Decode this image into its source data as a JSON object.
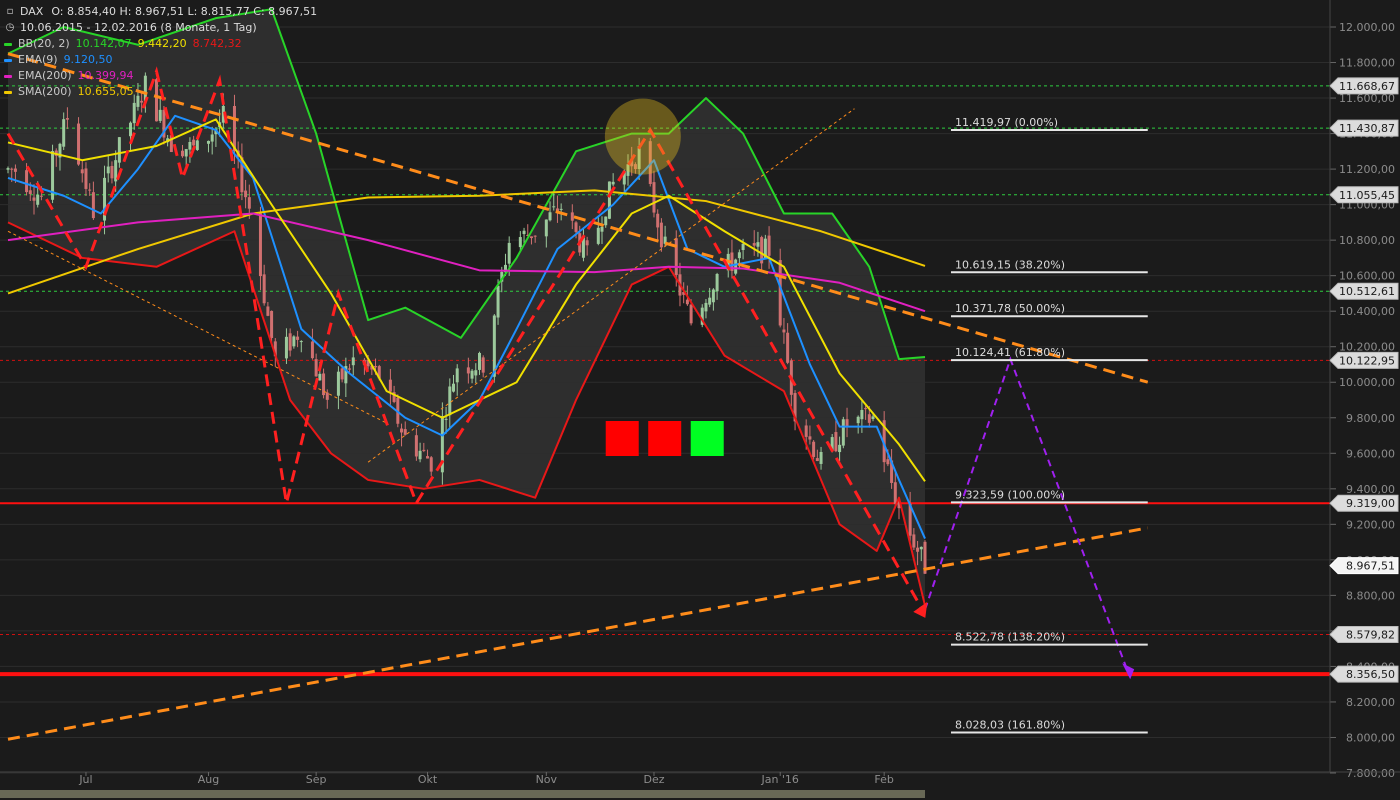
{
  "header": {
    "symbol": "DAX",
    "ohlc": "O: 8.854,40   H: 8.967,51   L: 8.815,77   C: 8.967,51",
    "period": "10.06.2015 - 12.02.2016 (8 Monate, 1 Tag)",
    "chart_icon": "candlestick-icon",
    "clock_icon": "clock-icon"
  },
  "legend": [
    {
      "name": "BB(20, 2)",
      "values": [
        "10.142,07",
        "9.442,20",
        "8.742,32"
      ],
      "colors": [
        "#28d428",
        "#f0e000",
        "#e81818"
      ],
      "color": "#28d428"
    },
    {
      "name": "EMA(9)",
      "values": [
        "9.120,50"
      ],
      "colors": [
        "#1e90ff"
      ],
      "color": "#1e90ff"
    },
    {
      "name": "EMA(200)",
      "values": [
        "10.399,94"
      ],
      "colors": [
        "#e020c0"
      ],
      "color": "#e020c0"
    },
    {
      "name": "SMA(200)",
      "values": [
        "10.655,05"
      ],
      "colors": [
        "#f0c800"
      ],
      "color": "#f0c800"
    }
  ],
  "colors": {
    "background": "#1b1b1b",
    "grid": "#2d2d2d",
    "axis_text": "#8c8c8c",
    "up": "#9cc99c",
    "down": "#d07070",
    "bb_mid": "#f0e000",
    "bb_upper": "#28d428",
    "bb_lower": "#e81818",
    "ema9": "#1e90ff",
    "ema200": "#e020c0",
    "sma200": "#f0c800",
    "trend": "#ff8c1a",
    "zigzag": "#ff2020",
    "projection": "#a020f0",
    "support": "#ff1010",
    "fib": "#e6e6e6",
    "hline": "#2ecc40"
  },
  "chart_data": {
    "type": "line",
    "title": "",
    "xlabel": "",
    "ylabel": "",
    "ylim": [
      7700,
      12100
    ],
    "y_ticks": [
      "12.000,00",
      "11.800,00",
      "11.600,00",
      "11.400,00",
      "11.200,00",
      "11.000,00",
      "10.800,00",
      "10.600,00",
      "10.400,00",
      "10.200,00",
      "10.000,00",
      "9.800,00",
      "9.600,00",
      "9.400,00",
      "9.200,00",
      "9.000,00",
      "8.800,00",
      "8.600,00",
      "8.400,00",
      "8.200,00",
      "8.000,00",
      "7.800,00"
    ],
    "x_labels": [
      {
        "label": "Jul",
        "date": "2015-07-01"
      },
      {
        "label": "Aug",
        "date": "2015-08-03"
      },
      {
        "label": "Sep",
        "date": "2015-09-01"
      },
      {
        "label": "Okt",
        "date": "2015-10-01"
      },
      {
        "label": "Nov",
        "date": "2015-11-02"
      },
      {
        "label": "Dez",
        "date": "2015-12-01"
      },
      {
        "label": "Jan '16",
        "date": "2016-01-04"
      },
      {
        "label": "Feb",
        "date": "2016-02-01"
      }
    ],
    "date_range": [
      "2015-06-10",
      "2016-02-12"
    ],
    "price_markers": [
      {
        "label": "11.668,67",
        "value": 11668.67,
        "style": "green"
      },
      {
        "label": "11.430,87",
        "value": 11430.87,
        "style": "green"
      },
      {
        "label": "11.055,45",
        "value": 11055.45,
        "style": "green"
      },
      {
        "label": "10.512,61",
        "value": 10512.61,
        "style": "green"
      },
      {
        "label": "10.122,95",
        "value": 10122.95,
        "style": "red-dotted"
      },
      {
        "label": "9.319,00",
        "value": 9319.0,
        "style": "red-solid"
      },
      {
        "label": "8.967,51",
        "value": 8967.51,
        "style": "current"
      },
      {
        "label": "8.579,82",
        "value": 8579.82,
        "style": "red-dotted"
      },
      {
        "label": "8.356,50",
        "value": 8356.5,
        "style": "red-thick"
      }
    ],
    "fibonacci": [
      {
        "label": "11.419,97 (0.00%)",
        "value": 11419.97
      },
      {
        "label": "10.619,15 (38.20%)",
        "value": 10619.15
      },
      {
        "label": "10.371,78 (50.00%)",
        "value": 10371.78
      },
      {
        "label": "10.124,41 (61.80%)",
        "value": 10124.41
      },
      {
        "label": "9.323,59 (100.00%)",
        "value": 9323.59
      },
      {
        "label": "8.522,78 (138.20%)",
        "value": 8522.78
      },
      {
        "label": "8.028,03 (161.80%)",
        "value": 8028.03
      }
    ],
    "fib_start_date": "2016-02-19",
    "fib_end_date": "2016-04-12",
    "candles_weekly_close": [
      [
        "2015-06-12",
        11197
      ],
      [
        "2015-06-19",
        11040
      ],
      [
        "2015-06-26",
        11492
      ],
      [
        "2015-07-03",
        10961
      ],
      [
        "2015-07-10",
        11316
      ],
      [
        "2015-07-17",
        11674
      ],
      [
        "2015-07-24",
        11347
      ],
      [
        "2015-07-31",
        11308
      ],
      [
        "2015-08-07",
        11490
      ],
      [
        "2015-08-14",
        10985
      ],
      [
        "2015-08-21",
        10124
      ],
      [
        "2015-08-28",
        10298
      ],
      [
        "2015-09-04",
        9902
      ],
      [
        "2015-09-11",
        10123
      ],
      [
        "2015-09-18",
        10038
      ],
      [
        "2015-09-25",
        9688
      ],
      [
        "2015-10-02",
        9553
      ],
      [
        "2015-10-09",
        10096
      ],
      [
        "2015-10-16",
        10104
      ],
      [
        "2015-10-23",
        10794
      ],
      [
        "2015-10-30",
        10850
      ],
      [
        "2015-11-06",
        10988
      ],
      [
        "2015-11-13",
        10708
      ],
      [
        "2015-11-20",
        11119
      ],
      [
        "2015-11-27",
        11293
      ],
      [
        "2015-12-04",
        10752
      ],
      [
        "2015-12-11",
        10340
      ],
      [
        "2015-12-18",
        10608
      ],
      [
        "2015-12-25",
        10727
      ],
      [
        "2016-01-01",
        10743
      ],
      [
        "2016-01-08",
        9849
      ],
      [
        "2016-01-15",
        9545
      ],
      [
        "2016-01-22",
        9764
      ],
      [
        "2016-01-29",
        9798
      ],
      [
        "2016-02-05",
        9286
      ],
      [
        "2016-02-12",
        8967
      ]
    ],
    "series": [
      {
        "name": "BB(20, 2)",
        "type": "line",
        "color": "#28d428",
        "points": [
          [
            "2015-06-10",
            11850
          ],
          [
            "2015-06-25",
            12000
          ],
          [
            "2015-07-15",
            11900
          ],
          [
            "2015-08-05",
            12050
          ],
          [
            "2015-08-20",
            12100
          ],
          [
            "2015-09-01",
            11400
          ],
          [
            "2015-09-15",
            10350
          ],
          [
            "2015-09-25",
            10420
          ],
          [
            "2015-10-10",
            10250
          ],
          [
            "2015-10-25",
            10700
          ],
          [
            "2015-11-10",
            11300
          ],
          [
            "2015-11-25",
            11400
          ],
          [
            "2015-12-05",
            11400
          ],
          [
            "2015-12-15",
            11600
          ],
          [
            "2015-12-25",
            11400
          ],
          [
            "2016-01-05",
            10950
          ],
          [
            "2016-01-18",
            10950
          ],
          [
            "2016-01-28",
            10650
          ],
          [
            "2016-02-05",
            10130
          ],
          [
            "2016-02-12",
            10142
          ]
        ]
      },
      {
        "name": "BB lower",
        "type": "line",
        "color": "#e81818",
        "points": [
          [
            "2015-06-10",
            10900
          ],
          [
            "2015-06-30",
            10700
          ],
          [
            "2015-07-20",
            10650
          ],
          [
            "2015-08-10",
            10850
          ],
          [
            "2015-08-25",
            9900
          ],
          [
            "2015-09-05",
            9600
          ],
          [
            "2015-09-15",
            9450
          ],
          [
            "2015-09-30",
            9400
          ],
          [
            "2015-10-15",
            9450
          ],
          [
            "2015-10-30",
            9350
          ],
          [
            "2015-11-10",
            9900
          ],
          [
            "2015-11-25",
            10550
          ],
          [
            "2015-12-05",
            10650
          ],
          [
            "2015-12-20",
            10150
          ],
          [
            "2016-01-05",
            9950
          ],
          [
            "2016-01-20",
            9200
          ],
          [
            "2016-01-30",
            9050
          ],
          [
            "2016-02-05",
            9350
          ],
          [
            "2016-02-12",
            8742
          ]
        ]
      },
      {
        "name": "EMA(9)",
        "type": "line",
        "color": "#1e90ff",
        "points": [
          [
            "2015-06-10",
            11150
          ],
          [
            "2015-06-25",
            11050
          ],
          [
            "2015-07-05",
            10950
          ],
          [
            "2015-07-15",
            11200
          ],
          [
            "2015-07-25",
            11500
          ],
          [
            "2015-08-05",
            11420
          ],
          [
            "2015-08-15",
            11150
          ],
          [
            "2015-08-28",
            10300
          ],
          [
            "2015-09-10",
            10050
          ],
          [
            "2015-09-25",
            9800
          ],
          [
            "2015-10-05",
            9700
          ],
          [
            "2015-10-15",
            9900
          ],
          [
            "2015-10-25",
            10300
          ],
          [
            "2015-11-05",
            10750
          ],
          [
            "2015-11-20",
            11000
          ],
          [
            "2015-12-01",
            11250
          ],
          [
            "2015-12-10",
            10750
          ],
          [
            "2015-12-20",
            10650
          ],
          [
            "2016-01-01",
            10700
          ],
          [
            "2016-01-12",
            10100
          ],
          [
            "2016-01-20",
            9750
          ],
          [
            "2016-01-30",
            9750
          ],
          [
            "2016-02-05",
            9450
          ],
          [
            "2016-02-12",
            9120
          ]
        ]
      },
      {
        "name": "SMA(200)",
        "type": "line",
        "color": "#f0c800",
        "points": [
          [
            "2015-06-10",
            10500
          ],
          [
            "2015-07-15",
            10750
          ],
          [
            "2015-08-15",
            10950
          ],
          [
            "2015-09-15",
            11040
          ],
          [
            "2015-10-15",
            11050
          ],
          [
            "2015-11-15",
            11080
          ],
          [
            "2015-12-15",
            11020
          ],
          [
            "2016-01-15",
            10850
          ],
          [
            "2016-02-12",
            10655
          ]
        ]
      },
      {
        "name": "EMA(200)",
        "type": "line",
        "color": "#e020c0",
        "points": [
          [
            "2015-06-10",
            10800
          ],
          [
            "2015-07-15",
            10900
          ],
          [
            "2015-08-15",
            10950
          ],
          [
            "2015-09-15",
            10800
          ],
          [
            "2015-10-15",
            10630
          ],
          [
            "2015-11-15",
            10620
          ],
          [
            "2015-12-05",
            10650
          ],
          [
            "2015-12-25",
            10640
          ],
          [
            "2016-01-20",
            10560
          ],
          [
            "2016-02-12",
            10400
          ]
        ]
      },
      {
        "name": "BB middle",
        "type": "line",
        "color": "#f0e000",
        "points": [
          [
            "2015-06-10",
            11350
          ],
          [
            "2015-06-30",
            11250
          ],
          [
            "2015-07-20",
            11330
          ],
          [
            "2015-08-05",
            11480
          ],
          [
            "2015-08-20",
            11000
          ],
          [
            "2015-09-05",
            10500
          ],
          [
            "2015-09-20",
            9950
          ],
          [
            "2015-10-05",
            9800
          ],
          [
            "2015-10-25",
            10000
          ],
          [
            "2015-11-10",
            10550
          ],
          [
            "2015-11-25",
            10950
          ],
          [
            "2015-12-05",
            11050
          ],
          [
            "2015-12-20",
            10850
          ],
          [
            "2016-01-05",
            10650
          ],
          [
            "2016-01-20",
            10050
          ],
          [
            "2016-02-05",
            9650
          ],
          [
            "2016-02-12",
            9442
          ]
        ]
      }
    ],
    "drawings": {
      "trendline_upper": [
        [
          "2015-06-10",
          11850
        ],
        [
          "2016-04-12",
          10000
        ]
      ],
      "trendline_lower": [
        [
          "2015-06-10",
          7990
        ],
        [
          "2016-04-12",
          9180
        ]
      ],
      "zigzag": [
        [
          "2015-06-10",
          11400
        ],
        [
          "2015-07-01",
          10650
        ],
        [
          "2015-07-20",
          11750
        ],
        [
          "2015-07-27",
          11150
        ],
        [
          "2015-08-06",
          11700
        ],
        [
          "2015-08-24",
          9320
        ],
        [
          "2015-09-07",
          10500
        ],
        [
          "2015-09-28",
          9320
        ],
        [
          "2015-11-30",
          11420
        ],
        [
          "2016-02-11",
          8730
        ]
      ],
      "projection": [
        [
          "2016-02-12",
          8720
        ],
        [
          "2016-03-06",
          10130
        ],
        [
          "2016-04-07",
          8350
        ]
      ],
      "thin_trend_1": [
        [
          "2015-06-10",
          10850
        ],
        [
          "2015-09-20",
          9770
        ]
      ],
      "thin_trend_2": [
        [
          "2015-09-15",
          9550
        ],
        [
          "2016-01-24",
          11540
        ]
      ],
      "highlight_date": "2015-11-28",
      "highlight_value": 11400,
      "boxes": [
        {
          "color": "#ff0000"
        },
        {
          "color": "#ff0000"
        },
        {
          "color": "#00ff22"
        }
      ]
    }
  }
}
